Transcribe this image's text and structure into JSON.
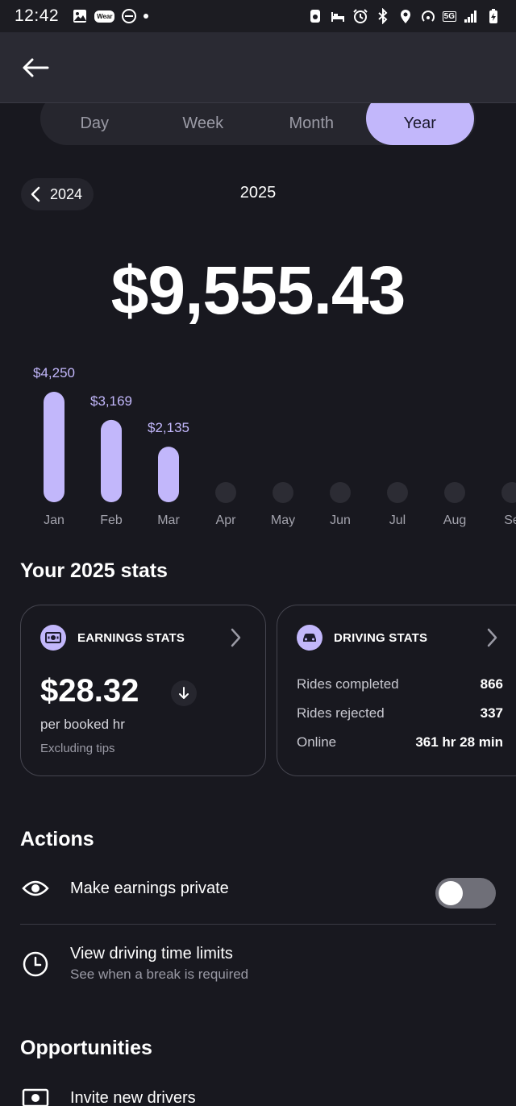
{
  "status_bar": {
    "time": "12:42",
    "wear_label": "Wear",
    "network_label": "5G"
  },
  "tabs": [
    {
      "label": "Day",
      "active": false
    },
    {
      "label": "Week",
      "active": false
    },
    {
      "label": "Month",
      "active": false
    },
    {
      "label": "Year",
      "active": true
    }
  ],
  "year_nav": {
    "previous_year": "2024",
    "current_year": "2025"
  },
  "total_earnings": "$9,555.43",
  "chart_data": {
    "type": "bar",
    "categories": [
      "Jan",
      "Feb",
      "Mar",
      "Apr",
      "May",
      "Jun",
      "Jul",
      "Aug",
      "Se"
    ],
    "values": [
      4250,
      3169,
      2135,
      0,
      0,
      0,
      0,
      0,
      0
    ],
    "value_labels": [
      "$4,250",
      "$3,169",
      "$2,135",
      "",
      "",
      "",
      "",
      "",
      ""
    ],
    "bar_color": "#c2b7fb",
    "empty_color": "#2c2c34",
    "label_color": "#c2b7fb"
  },
  "stats": {
    "title": "Your 2025 stats",
    "earnings": {
      "title": "EARNINGS STATS",
      "rate": "$28.32",
      "rate_unit": "per booked hr",
      "note": "Excluding tips",
      "icon": "money-icon",
      "trend": "down"
    },
    "driving": {
      "title": "DRIVING STATS",
      "icon": "car-icon",
      "rows": [
        {
          "label": "Rides completed",
          "value": "866"
        },
        {
          "label": "Rides rejected",
          "value": "337"
        },
        {
          "label": "Online",
          "value": "361 hr 28 min"
        }
      ]
    }
  },
  "actions": {
    "title": "Actions",
    "private": {
      "label": "Make earnings private",
      "icon": "eye-icon",
      "enabled": false
    },
    "limits": {
      "label": "View driving time limits",
      "sub": "See when a break is required",
      "icon": "clock-icon"
    }
  },
  "opportunities": {
    "title": "Opportunities",
    "invite": {
      "label": "Invite new drivers",
      "icon": "money-icon"
    }
  },
  "colors": {
    "background": "#18181f",
    "accent": "#c2b7fb",
    "header": "#2a2a33"
  }
}
